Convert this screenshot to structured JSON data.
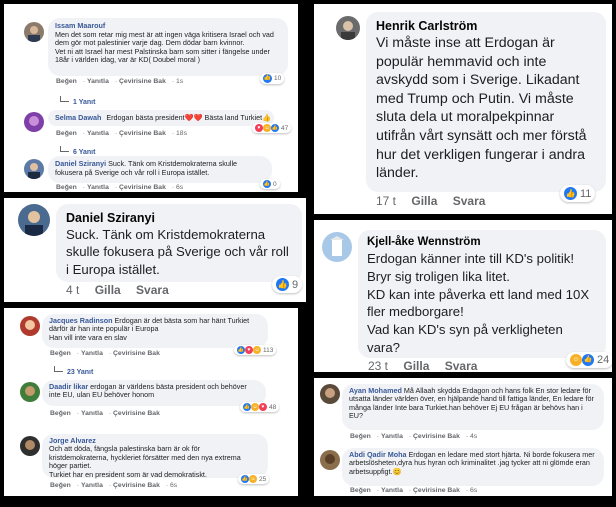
{
  "panel1": {
    "c1": {
      "name": "Issam Maarouf",
      "text": "Men det som retar mig mest är att ingen väga kritisera Israel och vad dem gör mot palestinier varje dag. Dem dödar barn kvinnor.\nVet ni att Israel har mest Palstinska barn som sitter i fängelse under 18år i världen idag, var är KD( Doubel moral )",
      "like": "Beğen",
      "reply": "Yanıtla",
      "translate": "Çevirisine Bak",
      "time": "1s",
      "reactions": "10",
      "replies": "1 Yanıt"
    },
    "c2": {
      "name": "Selma Dawah",
      "text": "Erdogan bästa president❤️❤️ Bästa land Turkiet👍",
      "like": "Beğen",
      "reply": "Yanıtla",
      "translate": "Çevirisine Bak",
      "time": "18s",
      "reactions": "47",
      "replies": "6 Yanıt"
    },
    "c3": {
      "name": "Daniel Sziranyi",
      "text": "Suck. Tänk om Kristdemokraterna skulle fokusera på Sverige och vår roll i Europa istället.",
      "like": "Beğen",
      "reply": "Yanıtla",
      "translate": "Çevirisine Bak",
      "time": "6s",
      "reactions": "0"
    }
  },
  "panel2": {
    "name": "Henrik Carlström",
    "text": "Vi måste inse att Erdogan är populär hemmavid och inte avskydd som i Sverige. Likadant med Trump och Putin. Vi måste sluta dela ut moralpekpinnar utifrån vårt synsätt och mer förstå hur det verkligen fungerar i andra länder.",
    "time": "17 t",
    "like": "Gilla",
    "reply": "Svara",
    "reactions": "11"
  },
  "panel3": {
    "name": "Daniel Sziranyi",
    "text": "Suck. Tänk om Kristdemokraterna skulle fokusera på Sverige och vår roll i Europa istället.",
    "time": "4 t",
    "like": "Gilla",
    "reply": "Svara",
    "reactions": "9"
  },
  "panel4": {
    "name": "Kjell-åke Wennström",
    "text": "Erdogan känner inte till KD's politik!\nBryr sig troligen lika litet.\nKD kan inte påverka ett land med 10X fler medborgare!\nVad kan KD's syn på verkligheten vara?",
    "time": "23 t",
    "like": "Gilla",
    "reply": "Svara",
    "reactions": "24"
  },
  "panel5": {
    "c1": {
      "name": "Jacques Radinson",
      "text": "Erdogan är det bästa som har hänt Turkiet därför är han inte populär i Europa\nHan vill inte vara en slav",
      "like": "Beğen",
      "reply": "Yanıtla",
      "translate": "Çevirisine Bak",
      "time": "",
      "reactions": "113",
      "replies": "23 Yanıt"
    },
    "c2": {
      "name": "Daadir likar",
      "text": "erdogan är världens bästa president och behöver inte EU, ulan EU behöver honom",
      "like": "Beğen",
      "reply": "Yanıtla",
      "translate": "Çevirisine Bak",
      "time": "",
      "reactions": "48"
    },
    "c3": {
      "name": "Jorge Alvarez",
      "text": "Och att döda, fängsla palestinska barn är ok för kristdemokraterna, hyckleriet försätter med den nya extrema höger partiet.\nTurkiet har en president som är vad demokratiskt.",
      "like": "Beğen",
      "reply": "Yanıtla",
      "translate": "Çevirisine Bak",
      "time": "6s",
      "reactions": "25"
    }
  },
  "panel6": {
    "c1": {
      "name": "Ayan Mohamed",
      "text": "Må Allaah skydda Erdagon och hans folk En stor ledare för utsatta länder världen över, en hjälpande hand till fattiga länder, En ledare för många länder Inte bara Turkiet.han behöver Ej EU frågan är behövs han i EU?",
      "like": "Beğen",
      "reply": "Yanıtla",
      "translate": "Çevirisine Bak",
      "time": "4s"
    },
    "c2": {
      "name": "Abdi Qadir Moha",
      "text": "Erdogan en ledare med stort hjärta. Ni borde fokusera mer arbetslösheten,dyra hus hyran och kriminalitet .jag tycker att ni glömde eran arbetsuppfigt.😊",
      "like": "Beğen",
      "reply": "Yanıtla",
      "translate": "Çevirisine Bak",
      "time": "6s"
    }
  },
  "colors": {
    "link": "#385898",
    "like": "#2078f4",
    "bubble": "#f0f2f5"
  }
}
